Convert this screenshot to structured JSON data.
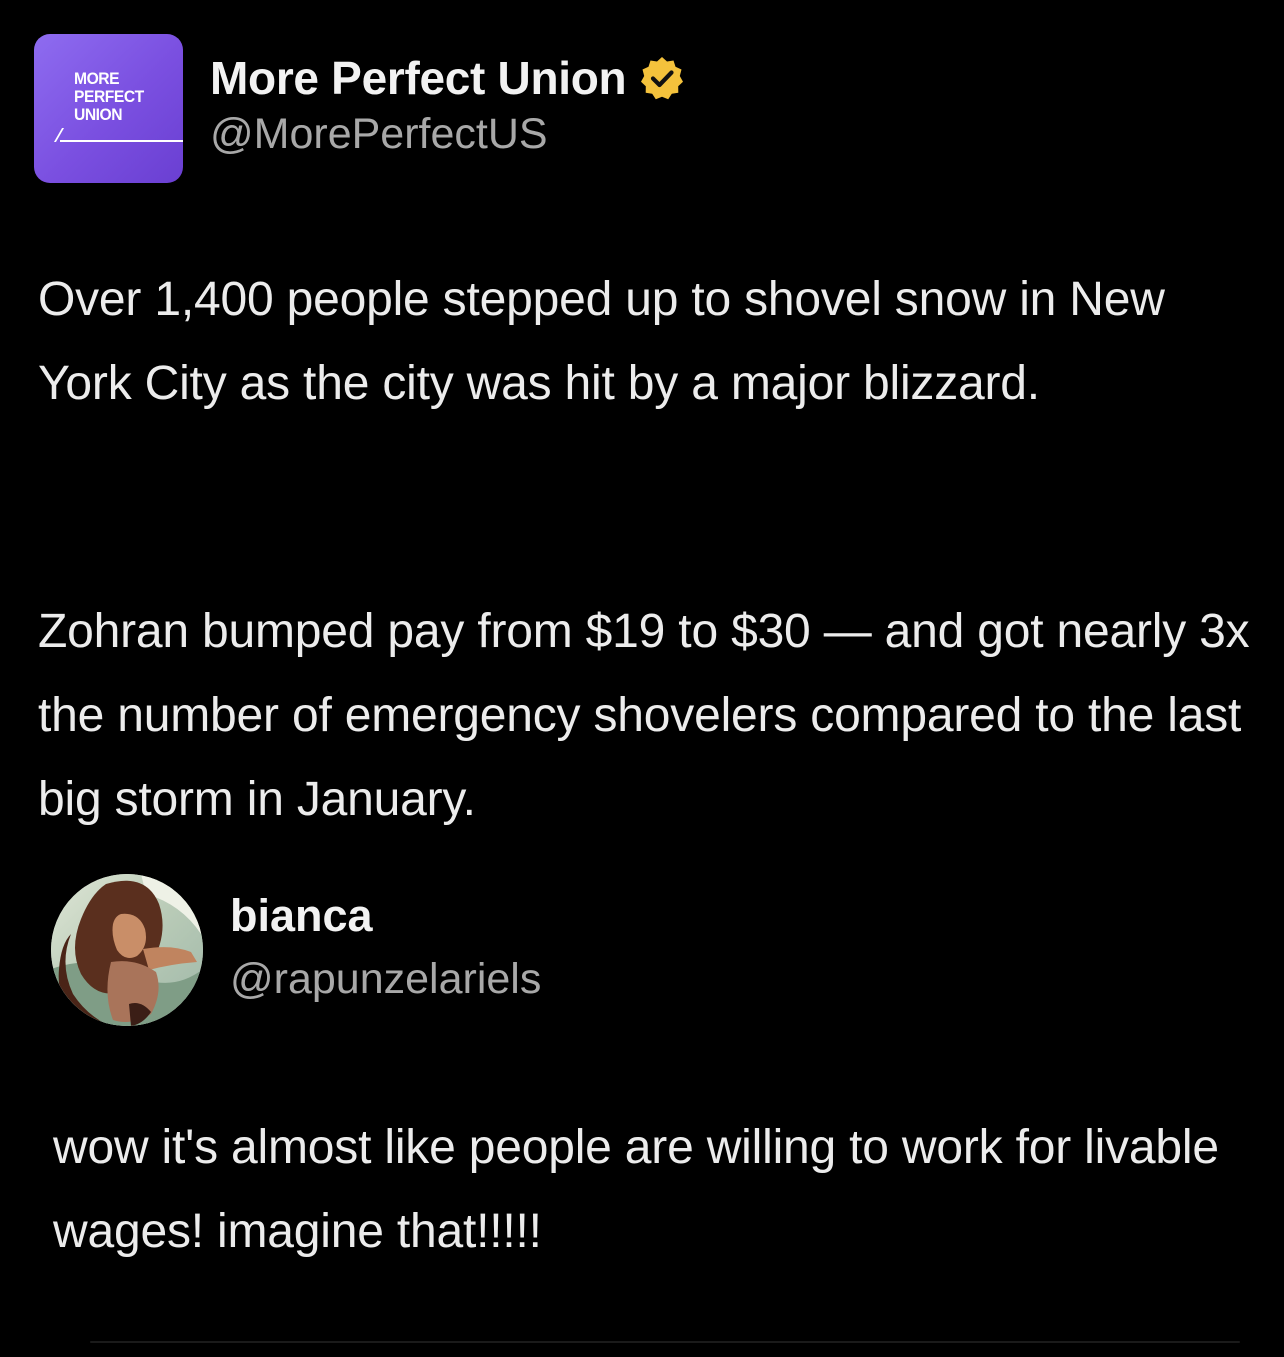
{
  "post": {
    "avatar": {
      "logo_lines": [
        "MORE",
        "PERFECT",
        "UNION"
      ],
      "bg_color": "#7a4fe0"
    },
    "display_name": "More Perfect Union",
    "verified": true,
    "verified_badge_color": "#f4c23c",
    "handle": "@MorePerfectUS",
    "paragraphs": [
      "Over 1,400 people stepped up to shovel snow in New York City as the city was hit by a major blizzard.",
      "Zohran bumped pay from $19 to $30 — and got nearly 3x the number of emergency shovelers compared to the last big storm in January."
    ]
  },
  "reply": {
    "display_name": "bianca",
    "handle": "@rapunzelariels",
    "text": "wow it's almost like people are willing to work for livable wages! imagine that!!!!!"
  }
}
